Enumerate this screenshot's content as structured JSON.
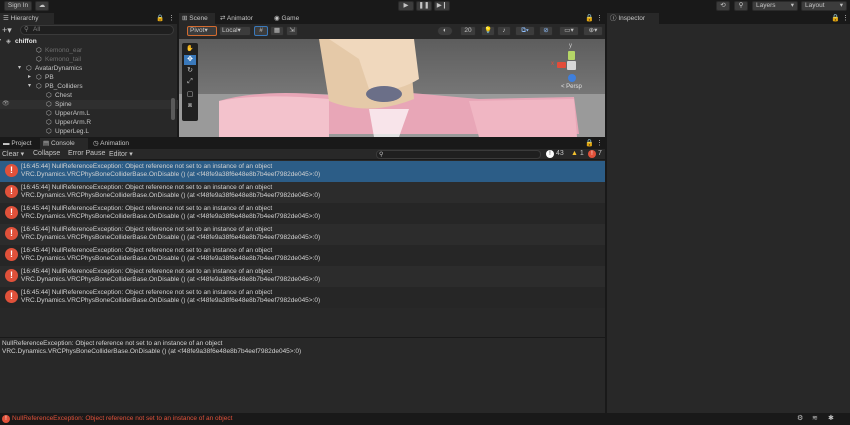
{
  "topbar": {
    "sign_in": "Sign In",
    "layers": "Layers",
    "layout": "Layout"
  },
  "hierarchy": {
    "tab": "Hierarchy",
    "search_placeholder": "All",
    "rows": [
      {
        "label": "chiffon",
        "depth": 0,
        "bold": true,
        "dim": false
      },
      {
        "label": "Kemono_ear",
        "depth": 3,
        "bold": false,
        "dim": true
      },
      {
        "label": "Kemono_tail",
        "depth": 3,
        "bold": false,
        "dim": true
      },
      {
        "label": "AvatarDynamics",
        "depth": 2,
        "bold": false,
        "dim": false
      },
      {
        "label": "PB",
        "depth": 3,
        "bold": false,
        "dim": false
      },
      {
        "label": "PB_Colliders",
        "depth": 3,
        "bold": false,
        "dim": false
      },
      {
        "label": "Chest",
        "depth": 4,
        "bold": false,
        "dim": false
      },
      {
        "label": "Spine",
        "depth": 4,
        "bold": false,
        "dim": false
      },
      {
        "label": "UpperArm.L",
        "depth": 4,
        "bold": false,
        "dim": false
      },
      {
        "label": "UpperArm.R",
        "depth": 4,
        "bold": false,
        "dim": false
      },
      {
        "label": "UpperLeg.L",
        "depth": 4,
        "bold": false,
        "dim": false
      },
      {
        "label": "UpperLeg.R",
        "depth": 4,
        "bold": false,
        "dim": false
      }
    ]
  },
  "scene": {
    "tabs": [
      "Scene",
      "Animator",
      "Game"
    ],
    "pivot": "Pivot",
    "local": "Local",
    "grid_value": "20",
    "persp": "< Persp",
    "axis_x": "x",
    "axis_y": "y"
  },
  "inspector": {
    "tab": "Inspector"
  },
  "console": {
    "tabs": [
      "Project",
      "Console",
      "Animation"
    ],
    "toolbar": [
      "Clear",
      "Collapse",
      "Error Pause",
      "Editor"
    ],
    "count_info": "43",
    "count_warn": "1",
    "count_error": "7",
    "entries": [
      {
        "line1": "[16:45:44] NullReferenceException: Object reference not set to an instance of an object",
        "line2": "VRC.Dynamics.VRCPhysBoneColliderBase.OnDisable () (at <f48fe9a38f6e48e8b7b4eef7982de045>:0)",
        "selected": true
      },
      {
        "line1": "[16:45:44] NullReferenceException: Object reference not set to an instance of an object",
        "line2": "VRC.Dynamics.VRCPhysBoneColliderBase.OnDisable () (at <f48fe9a38f6e48e8b7b4eef7982de045>:0)",
        "selected": false
      },
      {
        "line1": "[16:45:44] NullReferenceException: Object reference not set to an instance of an object",
        "line2": "VRC.Dynamics.VRCPhysBoneColliderBase.OnDisable () (at <f48fe9a38f6e48e8b7b4eef7982de045>:0)",
        "selected": false
      },
      {
        "line1": "[16:45:44] NullReferenceException: Object reference not set to an instance of an object",
        "line2": "VRC.Dynamics.VRCPhysBoneColliderBase.OnDisable () (at <f48fe9a38f6e48e8b7b4eef7982de045>:0)",
        "selected": false
      },
      {
        "line1": "[16:45:44] NullReferenceException: Object reference not set to an instance of an object",
        "line2": "VRC.Dynamics.VRCPhysBoneColliderBase.OnDisable () (at <f48fe9a38f6e48e8b7b4eef7982de045>:0)",
        "selected": false
      },
      {
        "line1": "[16:45:44] NullReferenceException: Object reference not set to an instance of an object",
        "line2": "VRC.Dynamics.VRCPhysBoneColliderBase.OnDisable () (at <f48fe9a38f6e48e8b7b4eef7982de045>:0)",
        "selected": false
      },
      {
        "line1": "[16:45:44] NullReferenceException: Object reference not set to an instance of an object",
        "line2": "VRC.Dynamics.VRCPhysBoneColliderBase.OnDisable () (at <f48fe9a38f6e48e8b7b4eef7982de045>:0)",
        "selected": false
      }
    ],
    "detail_line1": "NullReferenceException: Object reference not set to an instance of an object",
    "detail_line2": "VRC.Dynamics.VRCPhysBoneColliderBase.OnDisable () (at <f48fe9a38f6e48e8b7b4eef7982de045>:0)"
  },
  "status": {
    "message": "NullReferenceException: Object reference not set to an instance of an object",
    "error_color": "#e0513a"
  },
  "colors": {
    "selected_row": "#2c5d87",
    "panel": "#282828",
    "accent_blue": "#3a79bb"
  }
}
